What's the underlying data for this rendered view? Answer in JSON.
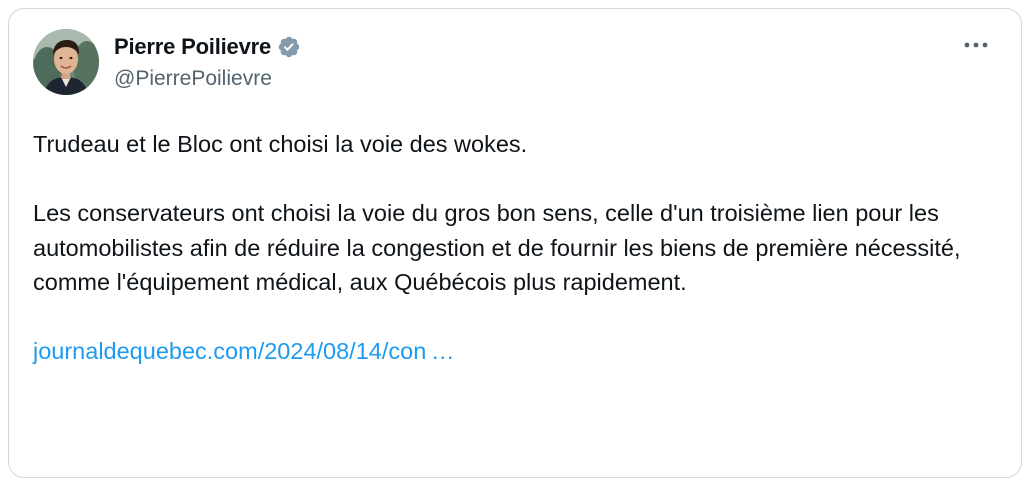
{
  "tweet": {
    "author": {
      "display_name": "Pierre Poilievre",
      "handle": "@PierrePoilievre",
      "verified": true
    },
    "paragraphs": [
      "Trudeau et le Bloc ont choisi la voie des wokes.",
      "Les conservateurs ont choisi la voie du gros bon sens, celle d'un troisième lien pour les automobilistes afin de réduire la congestion et de fournir les biens de première nécessité, comme l'équipement médical, aux Québécois plus rapidement."
    ],
    "link_text": "journaldequebec.com/2024/08/14/con …"
  },
  "colors": {
    "text": "#0f1419",
    "secondary": "#536471",
    "link": "#1d9bf0",
    "verified_badge": "#829aab",
    "border": "#cfd9de"
  },
  "icons": {
    "verified": "verified-badge-icon",
    "more": "more-horizontal-icon"
  }
}
